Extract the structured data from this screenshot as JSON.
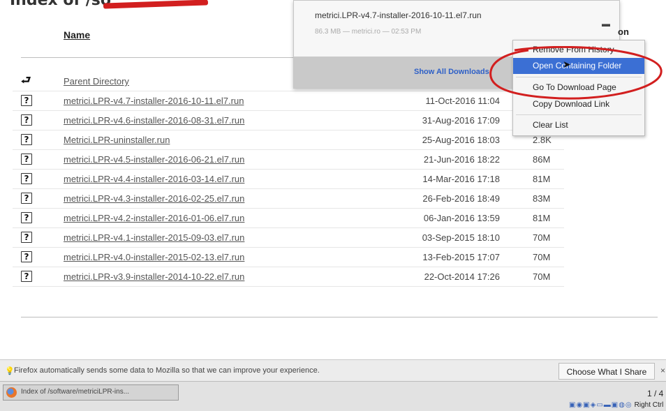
{
  "page": {
    "heading": "Index of /so"
  },
  "listing": {
    "name_header": "Name",
    "rows": [
      {
        "icon": "back-arrow-icon",
        "name": "Parent Directory",
        "date": "",
        "size": ""
      },
      {
        "icon": "unknown-file-icon",
        "name": "metrici.LPR-v4.7-installer-2016-10-11.el7.run",
        "date": "11-Oct-2016 11:04",
        "size": ""
      },
      {
        "icon": "unknown-file-icon",
        "name": "metrici.LPR-v4.6-installer-2016-08-31.el7.run",
        "date": "31-Aug-2016 17:09",
        "size": ""
      },
      {
        "icon": "unknown-file-icon",
        "name": "Metrici.LPR-uninstaller.run",
        "date": "25-Aug-2016 18:03",
        "size": "2.8K"
      },
      {
        "icon": "unknown-file-icon",
        "name": "metrici.LPR-v4.5-installer-2016-06-21.el7.run",
        "date": "21-Jun-2016 18:22",
        "size": "86M"
      },
      {
        "icon": "unknown-file-icon",
        "name": "metrici.LPR-v4.4-installer-2016-03-14.el7.run",
        "date": "14-Mar-2016 17:18",
        "size": "81M"
      },
      {
        "icon": "unknown-file-icon",
        "name": "metrici.LPR-v4.3-installer-2016-02-25.el7.run",
        "date": "26-Feb-2016 18:49",
        "size": "83M"
      },
      {
        "icon": "unknown-file-icon",
        "name": "metrici.LPR-v4.2-installer-2016-01-06.el7.run",
        "date": "06-Jan-2016 13:59",
        "size": "81M"
      },
      {
        "icon": "unknown-file-icon",
        "name": "metrici.LPR-v4.1-installer-2015-09-03.el7.run",
        "date": "03-Sep-2015 18:10",
        "size": "70M"
      },
      {
        "icon": "unknown-file-icon",
        "name": "metrici.LPR-v4.0-installer-2015-02-13.el7.run",
        "date": "13-Feb-2015 17:07",
        "size": "70M"
      },
      {
        "icon": "unknown-file-icon",
        "name": "metrici.LPR-v3.9-installer-2014-10-22.el7.run",
        "date": "22-Oct-2014 17:26",
        "size": "70M"
      }
    ]
  },
  "downloads_panel": {
    "file_name": "metrici.LPR-v4.7-installer-2016-10-11.el7.run",
    "meta": "86.3 MB — metrici.ro — 02:53 PM",
    "show_all": "Show All Downloads",
    "partial_header": "on"
  },
  "context_menu": {
    "items": [
      {
        "label": "Remove From History",
        "highlighted": false
      },
      {
        "label": "Open Containing Folder",
        "highlighted": true
      },
      {
        "label": "Go To Download Page",
        "highlighted": false
      },
      {
        "label": "Copy Download Link",
        "highlighted": false
      },
      {
        "label": "Clear List",
        "highlighted": false
      }
    ],
    "highlight_color": "#3b6fd4",
    "annotation_color": "#d21f1f"
  },
  "notification": {
    "text": "Firefox automatically sends some data to Mozilla so that we can improve your experience.",
    "button": "Choose What I Share",
    "close": "×"
  },
  "taskbar": {
    "task_title": "Index of /software/metriciLPR-ins...",
    "pager": "1 / 4",
    "tray_label": "Right Ctrl"
  }
}
